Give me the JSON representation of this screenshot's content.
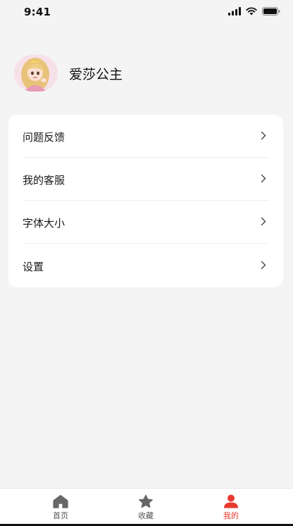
{
  "status_bar": {
    "time": "9:41",
    "icons": [
      "signal-icon",
      "wifi-icon",
      "battery-icon"
    ]
  },
  "profile": {
    "name": "爱莎公主",
    "avatar": "princess-avatar"
  },
  "menu": {
    "items": [
      {
        "label": "问题反馈",
        "icon": "chevron-right-icon"
      },
      {
        "label": "我的客服",
        "icon": "chevron-right-icon"
      },
      {
        "label": "字体大小",
        "icon": "chevron-right-icon"
      },
      {
        "label": "设置",
        "icon": "chevron-right-icon"
      }
    ]
  },
  "tab_bar": {
    "tabs": [
      {
        "label": "首页",
        "icon": "home-icon",
        "active": false
      },
      {
        "label": "收藏",
        "icon": "star-icon",
        "active": false
      },
      {
        "label": "我的",
        "icon": "user-icon",
        "active": true
      }
    ]
  },
  "colors": {
    "background": "#f4f4f4",
    "card": "#ffffff",
    "accent": "#e8392f",
    "inactive_icon": "#666666"
  }
}
